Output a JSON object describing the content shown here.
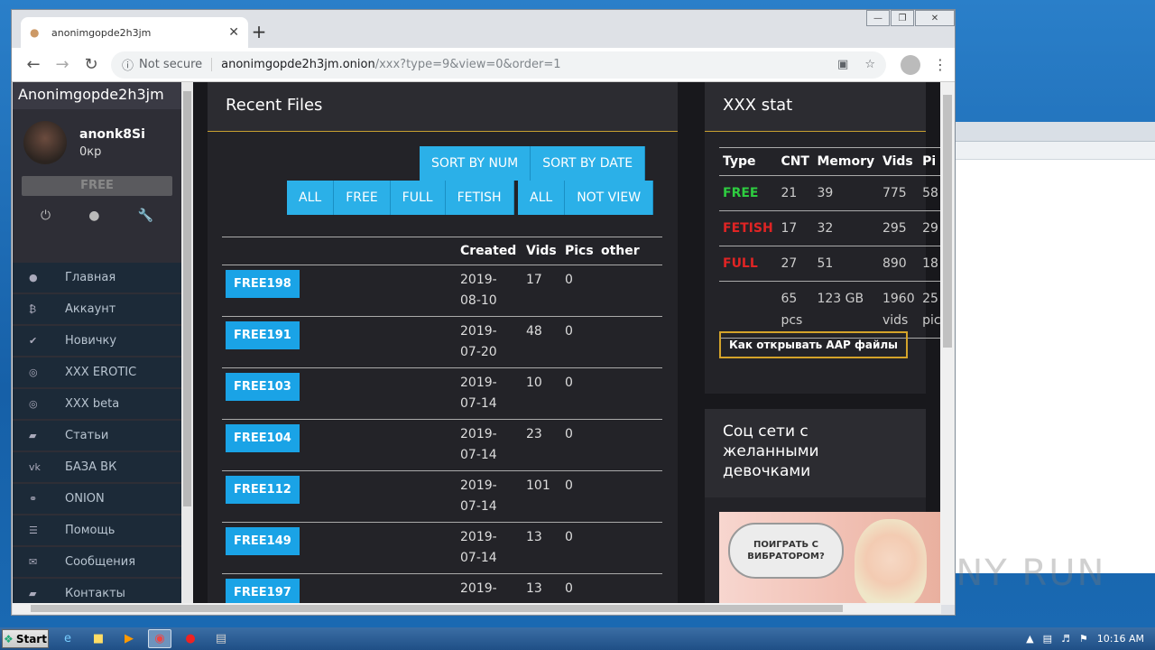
{
  "browser": {
    "tab_title": "anonimgopde2h3jm",
    "not_secure": "Not secure",
    "url_host": "anonimgopde2h3jm.onion",
    "url_path": "/xxx?type=9&view=0&order=1"
  },
  "sidebar": {
    "brand": "Anonimgopde2h3jm",
    "username": "anonk8Si",
    "balance": "0кр",
    "free_label": "FREE",
    "menu": [
      {
        "icon": "●",
        "label": "Главная"
      },
      {
        "icon": "₿",
        "label": "Аккаунт"
      },
      {
        "icon": "✔",
        "label": "Новичку"
      },
      {
        "icon": "◎",
        "label": "XXX EROTIC"
      },
      {
        "icon": "◎",
        "label": "XXX beta"
      },
      {
        "icon": "▰",
        "label": "Статьи"
      },
      {
        "icon": "vk",
        "label": "БАЗА ВК"
      },
      {
        "icon": "⚭",
        "label": "ONION"
      },
      {
        "icon": "☰",
        "label": "Помощь"
      },
      {
        "icon": "✉",
        "label": "Сообщения"
      },
      {
        "icon": "▰",
        "label": "Контакты"
      }
    ]
  },
  "recent": {
    "title": "Recent Files",
    "sort_num": "SORT BY NUM",
    "sort_date": "SORT BY DATE",
    "filter_all": "ALL",
    "filter_free": "FREE",
    "filter_full": "FULL",
    "filter_fetish": "FETISH",
    "view_all": "ALL",
    "view_not": "NOT VIEW",
    "headers": {
      "created": "Created",
      "vids": "Vids",
      "pics": "Pics",
      "other": "other"
    },
    "rows": [
      {
        "name": "FREE198",
        "date1": "2019-",
        "date2": "08-10",
        "vids": "17",
        "pics": "0"
      },
      {
        "name": "FREE191",
        "date1": "2019-",
        "date2": "07-20",
        "vids": "48",
        "pics": "0"
      },
      {
        "name": "FREE103",
        "date1": "2019-",
        "date2": "07-14",
        "vids": "10",
        "pics": "0"
      },
      {
        "name": "FREE104",
        "date1": "2019-",
        "date2": "07-14",
        "vids": "23",
        "pics": "0"
      },
      {
        "name": "FREE112",
        "date1": "2019-",
        "date2": "07-14",
        "vids": "101",
        "pics": "0"
      },
      {
        "name": "FREE149",
        "date1": "2019-",
        "date2": "07-14",
        "vids": "13",
        "pics": "0"
      },
      {
        "name": "FREE197",
        "date1": "2019-",
        "date2": "",
        "vids": "13",
        "pics": "0"
      }
    ]
  },
  "stat": {
    "title": "XXX stat",
    "headers": {
      "type": "Type",
      "cnt": "CNT",
      "memory": "Memory",
      "vids": "Vids",
      "pics": "Pi"
    },
    "rows": [
      {
        "type": "FREE",
        "cnt": "21",
        "memory": "39",
        "vids": "775",
        "pics": "58"
      },
      {
        "type": "FETISH",
        "cnt": "17",
        "memory": "32",
        "vids": "295",
        "pics": "29"
      },
      {
        "type": "FULL",
        "cnt": "27",
        "memory": "51",
        "vids": "890",
        "pics": "18"
      }
    ],
    "total": {
      "cnt1": "65",
      "cnt2": "pcs",
      "memory": "123 GB",
      "vids1": "1960",
      "vids2": "vids",
      "pics1": "25",
      "pics2": "pic"
    },
    "aap_button": "Как открывать AAP файлы"
  },
  "social": {
    "title": "Соц сети с желанными девочками",
    "ad_text": "ПОИГРАТЬ С ВИБРАТОРОМ?"
  },
  "watermark": "ANY RUN",
  "taskbar": {
    "start": "Start",
    "clock": "10:16 AM"
  }
}
